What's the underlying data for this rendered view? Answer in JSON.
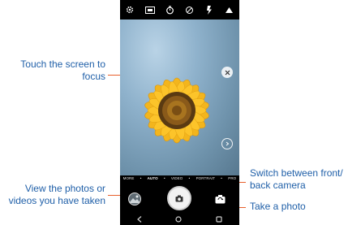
{
  "callouts": {
    "focus": "Touch the screen to focus",
    "gallery": "View the photos or videos you have taken",
    "switch": "Switch between front/ back camera",
    "shutter": "Take a photo"
  },
  "camera": {
    "modes": [
      "MORE",
      "AUTO",
      "VIDEO",
      "PORTRAIT",
      "PRO"
    ],
    "active_mode": "AUTO",
    "top_icons": [
      "settings-icon",
      "aspect-ratio-icon",
      "timer-icon",
      "hdr-icon",
      "flash-icon",
      "filter-icon"
    ],
    "nav_icons": [
      "back-icon",
      "home-icon",
      "recents-icon"
    ]
  },
  "colors": {
    "callout_text": "#1f5fa8",
    "leader_line": "#e8602c",
    "phone_bg": "#000000"
  }
}
